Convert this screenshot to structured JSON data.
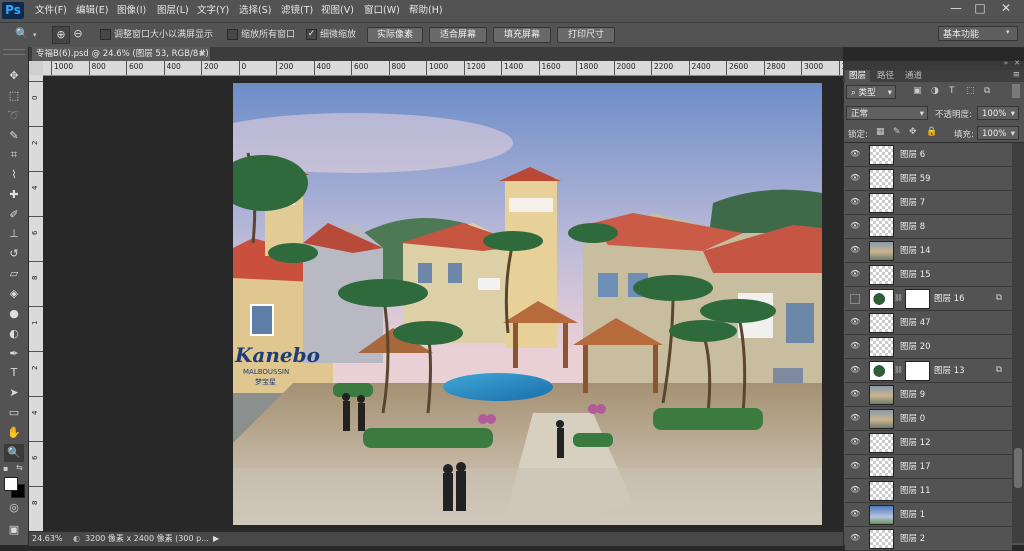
{
  "app": {
    "logo": "Ps"
  },
  "menubar": {
    "items": [
      "文件(F)",
      "编辑(E)",
      "图像(I)",
      "图层(L)",
      "文字(Y)",
      "选择(S)",
      "滤镜(T)",
      "视图(V)",
      "窗口(W)",
      "帮助(H)"
    ],
    "window_buttons": [
      "—",
      "□",
      "✕"
    ]
  },
  "options": {
    "checkbox1_label": "调整窗口大小以满屏显示",
    "checkbox2_label": "缩放所有窗口",
    "checkbox3_label": "细微缩放",
    "btn_actual": "实际像素",
    "btn_fit": "适合屏幕",
    "btn_fill": "填充屏幕",
    "btn_print": "打印尺寸",
    "workspace": "基本功能"
  },
  "document": {
    "tab_title": "专福B(6).psd @ 24.6% (图层 53, RGB/8#)",
    "tab_close": "×",
    "hruler_labels": [
      "1000",
      "800",
      "600",
      "400",
      "200",
      "0",
      "200",
      "400",
      "600",
      "800",
      "1000",
      "1200",
      "1400",
      "1600",
      "1800",
      "2000",
      "2200",
      "2400",
      "2600",
      "2800",
      "3000",
      "3200"
    ],
    "vruler_labels": [
      "0",
      "2",
      "4",
      "6",
      "8",
      "1",
      "2",
      "4",
      "6",
      "8"
    ]
  },
  "image_text": {
    "sign_main": "Kanebo",
    "sign_sub": "MALBOUSSIN",
    "sign_cn": "梦宝星"
  },
  "status": {
    "zoom": "24.63%",
    "size": "3200 像素 x 2400 像素 (300 p..."
  },
  "panel": {
    "tabs": [
      "图层",
      "路径",
      "通道"
    ],
    "filter_kind": "类型",
    "blend_mode": "正常",
    "opacity_label": "不透明度:",
    "opacity_value": "100%",
    "lock_label": "锁定:",
    "fill_label": "填充:",
    "fill_value": "100%",
    "layers": [
      {
        "name": "图层 6",
        "visible": true,
        "mask": false,
        "thumb": "checker"
      },
      {
        "name": "图层 59",
        "visible": true,
        "mask": false,
        "thumb": "checker"
      },
      {
        "name": "图层 7",
        "visible": true,
        "mask": false,
        "thumb": "checker"
      },
      {
        "name": "图层 8",
        "visible": true,
        "mask": false,
        "thumb": "checker"
      },
      {
        "name": "图层 14",
        "visible": true,
        "mask": false,
        "thumb": "scene"
      },
      {
        "name": "图层 15",
        "visible": true,
        "mask": false,
        "thumb": "checker"
      },
      {
        "name": "图层 16",
        "visible": false,
        "mask": true,
        "thumb": "plant"
      },
      {
        "name": "图层 47",
        "visible": true,
        "mask": false,
        "thumb": "checker"
      },
      {
        "name": "图层 20",
        "visible": true,
        "mask": false,
        "thumb": "checker"
      },
      {
        "name": "图层 13",
        "visible": true,
        "mask": true,
        "thumb": "plant"
      },
      {
        "name": "图层 9",
        "visible": true,
        "mask": false,
        "thumb": "scene"
      },
      {
        "name": "图层 0",
        "visible": true,
        "mask": false,
        "thumb": "scene"
      },
      {
        "name": "图层 12",
        "visible": true,
        "mask": false,
        "thumb": "checker"
      },
      {
        "name": "图层 17",
        "visible": true,
        "mask": false,
        "thumb": "checker"
      },
      {
        "name": "图层 11",
        "visible": true,
        "mask": false,
        "thumb": "checker"
      },
      {
        "name": "图层 1",
        "visible": true,
        "mask": false,
        "thumb": "sky"
      },
      {
        "name": "图层 2",
        "visible": true,
        "mask": false,
        "thumb": "checker"
      }
    ]
  }
}
